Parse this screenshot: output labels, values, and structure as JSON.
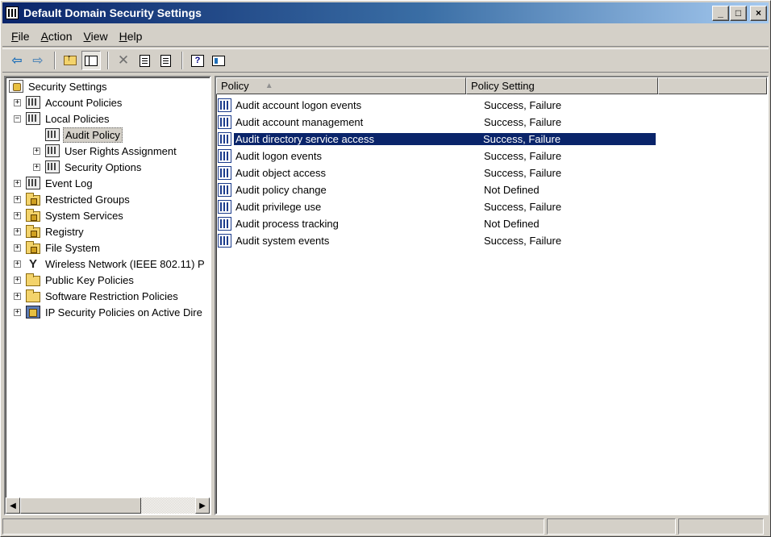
{
  "window": {
    "title": "Default Domain Security Settings",
    "controls": {
      "minimize": "_",
      "maximize": "□",
      "close": "×"
    }
  },
  "menu": [
    {
      "accel": "F",
      "rest": "ile"
    },
    {
      "accel": "A",
      "rest": "ction"
    },
    {
      "accel": "V",
      "rest": "iew"
    },
    {
      "accel": "H",
      "rest": "elp"
    }
  ],
  "toolbar": {
    "back": "⇦",
    "forward": "⇨",
    "delete": "✕",
    "icons": [
      "back-arrow-icon",
      "forward-arrow-icon",
      "up-one-level-icon",
      "show-hide-tree-icon",
      "delete-icon",
      "properties-icon",
      "export-list-icon",
      "help-icon",
      "show-hide-action-pane-icon"
    ]
  },
  "tree": {
    "items": [
      {
        "label": "Security Settings",
        "expander": "",
        "icon": "security-settings-icon"
      },
      {
        "label": "Account Policies",
        "expander": "+",
        "icon": "policy-icon"
      },
      {
        "label": "Local Policies",
        "expander": "−",
        "icon": "policy-icon"
      },
      {
        "label": "Audit Policy",
        "expander": "",
        "icon": "policy-icon",
        "selected": true
      },
      {
        "label": "User Rights Assignment",
        "expander": "+",
        "icon": "policy-icon"
      },
      {
        "label": "Security Options",
        "expander": "+",
        "icon": "policy-icon"
      },
      {
        "label": "Event Log",
        "expander": "+",
        "icon": "policy-icon"
      },
      {
        "label": "Restricted Groups",
        "expander": "+",
        "icon": "locked-folder-icon"
      },
      {
        "label": "System Services",
        "expander": "+",
        "icon": "locked-folder-icon"
      },
      {
        "label": "Registry",
        "expander": "+",
        "icon": "locked-folder-icon"
      },
      {
        "label": "File System",
        "expander": "+",
        "icon": "locked-folder-icon"
      },
      {
        "label": "Wireless Network (IEEE 802.11) P",
        "expander": "+",
        "icon": "antenna-icon"
      },
      {
        "label": "Public Key Policies",
        "expander": "+",
        "icon": "folder-icon"
      },
      {
        "label": "Software Restriction Policies",
        "expander": "+",
        "icon": "folder-icon"
      },
      {
        "label": "IP Security Policies on Active Dire",
        "expander": "+",
        "icon": "ip-security-icon"
      }
    ]
  },
  "list": {
    "columns": {
      "policy": "Policy",
      "setting": "Policy Setting",
      "sort_glyph": "▲"
    },
    "rows": [
      {
        "policy": "Audit account logon events",
        "setting": "Success, Failure"
      },
      {
        "policy": "Audit account management",
        "setting": "Success, Failure"
      },
      {
        "policy": "Audit directory service access",
        "setting": "Success, Failure",
        "selected": true
      },
      {
        "policy": "Audit logon events",
        "setting": "Success, Failure"
      },
      {
        "policy": "Audit object access",
        "setting": "Success, Failure"
      },
      {
        "policy": "Audit policy change",
        "setting": "Not Defined"
      },
      {
        "policy": "Audit privilege use",
        "setting": "Success, Failure"
      },
      {
        "policy": "Audit process tracking",
        "setting": "Not Defined"
      },
      {
        "policy": "Audit system events",
        "setting": "Success, Failure"
      }
    ]
  },
  "scrollbar": {
    "left_arrow": "◀",
    "right_arrow": "▶"
  },
  "colors": {
    "selection": "#0a246a",
    "titlebar_start": "#0a246a",
    "face": "#d4d0c8"
  }
}
